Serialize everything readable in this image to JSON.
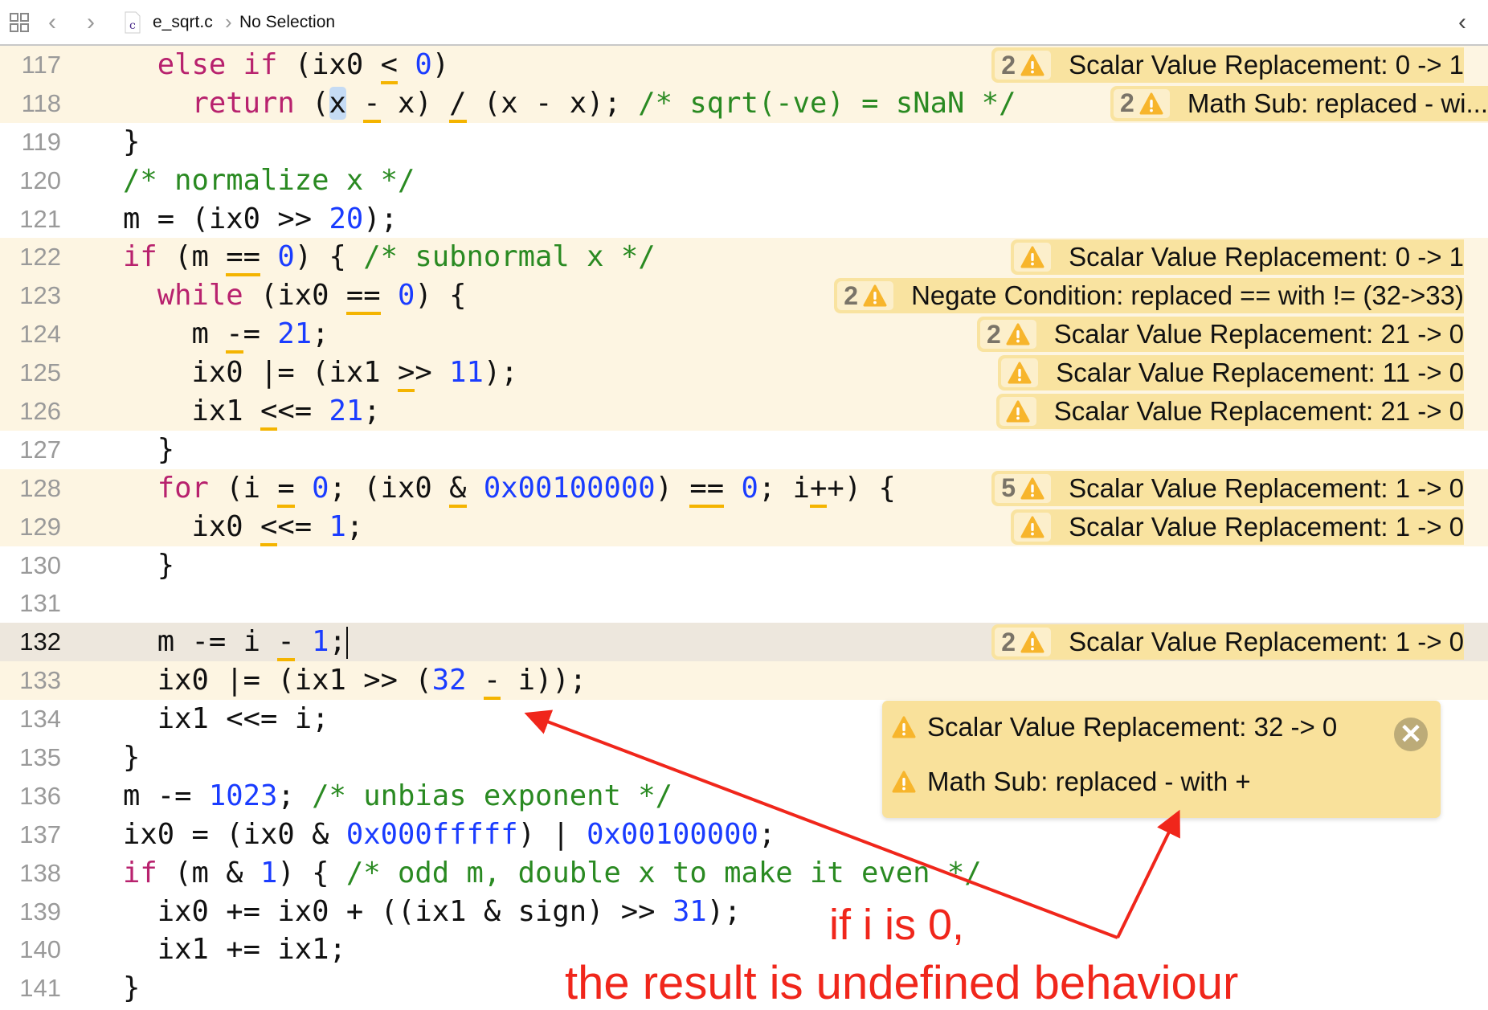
{
  "toolbar": {
    "file_name": "e_sqrt.c",
    "file_type_letter": "c",
    "selection": "No Selection",
    "icons": [
      "related-items-grid-icon",
      "back-chevron-icon",
      "forward-chevron-icon",
      "c-file-icon",
      "breadcrumb-chevron-icon",
      "issue-nav-back-icon"
    ]
  },
  "colors": {
    "keyword": "#b8226e",
    "number": "#1a3cff",
    "comment": "#2a8a22",
    "mutation_underline": "#f4b400",
    "annotation_bg": "#f9e3a0",
    "row_highlight": "#fdf5e2",
    "current_line": "#ede7dd",
    "annotation_red": "#f0261b"
  },
  "current_line": 132,
  "lines": [
    {
      "n": "117",
      "hl": true,
      "tokens": [
        [
          "p",
          "  "
        ],
        [
          "k",
          "else if"
        ],
        [
          "p",
          " (ix0 "
        ],
        [
          "m",
          "<"
        ],
        [
          "p",
          " "
        ],
        [
          "n",
          "0"
        ],
        [
          "p",
          ")"
        ]
      ],
      "ann": {
        "count": "2",
        "text": "Scalar Value Replacement: 0 -> 1"
      }
    },
    {
      "n": "118",
      "hl": true,
      "tokens": [
        [
          "p",
          "    "
        ],
        [
          "k",
          "return"
        ],
        [
          "p",
          " ("
        ],
        [
          "s",
          "x"
        ],
        [
          "p",
          " "
        ],
        [
          "m",
          "-"
        ],
        [
          "p",
          " x) "
        ],
        [
          "m",
          "/"
        ],
        [
          "p",
          " (x - x); "
        ],
        [
          "c",
          "/* sqrt(-ve) = sNaN */"
        ]
      ],
      "ann": {
        "count": "2",
        "text": "Math Sub: replaced - wi...",
        "truncated": true
      }
    },
    {
      "n": "119",
      "tokens": [
        [
          "p",
          "}"
        ]
      ]
    },
    {
      "n": "120",
      "tokens": [
        [
          "c",
          "/* normalize x */"
        ]
      ]
    },
    {
      "n": "121",
      "tokens": [
        [
          "p",
          "m = (ix0 >> "
        ],
        [
          "n",
          "20"
        ],
        [
          "p",
          ");"
        ]
      ]
    },
    {
      "n": "122",
      "hl": true,
      "tokens": [
        [
          "k",
          "if"
        ],
        [
          "p",
          " (m "
        ],
        [
          "m",
          "=="
        ],
        [
          "p",
          " "
        ],
        [
          "n",
          "0"
        ],
        [
          "p",
          ") { "
        ],
        [
          "c",
          "/* subnormal x */"
        ]
      ],
      "ann": {
        "count": "",
        "text": "Scalar Value Replacement: 0 -> 1"
      }
    },
    {
      "n": "123",
      "hl": true,
      "tokens": [
        [
          "p",
          "  "
        ],
        [
          "k",
          "while"
        ],
        [
          "p",
          " (ix0 "
        ],
        [
          "m",
          "=="
        ],
        [
          "p",
          " "
        ],
        [
          "n",
          "0"
        ],
        [
          "p",
          ") {"
        ]
      ],
      "ann": {
        "count": "2",
        "text": "Negate Condition: replaced == with != (32->33)"
      }
    },
    {
      "n": "124",
      "hl": true,
      "tokens": [
        [
          "p",
          "    m "
        ],
        [
          "m",
          "-"
        ],
        [
          "p",
          "= "
        ],
        [
          "n",
          "21"
        ],
        [
          "p",
          ";"
        ]
      ],
      "ann": {
        "count": "2",
        "text": "Scalar Value Replacement: 21 -> 0"
      }
    },
    {
      "n": "125",
      "hl": true,
      "tokens": [
        [
          "p",
          "    ix0 |= (ix1 "
        ],
        [
          "m",
          ">"
        ],
        [
          "p",
          "> "
        ],
        [
          "n",
          "11"
        ],
        [
          "p",
          ");"
        ]
      ],
      "ann": {
        "count": "",
        "text": "Scalar Value Replacement: 11 -> 0"
      }
    },
    {
      "n": "126",
      "hl": true,
      "tokens": [
        [
          "p",
          "    ix1 "
        ],
        [
          "m",
          "<"
        ],
        [
          "p",
          "<= "
        ],
        [
          "n",
          "21"
        ],
        [
          "p",
          ";"
        ]
      ],
      "ann": {
        "count": "",
        "text": "Scalar Value Replacement: 21 -> 0"
      }
    },
    {
      "n": "127",
      "tokens": [
        [
          "p",
          "  }"
        ]
      ]
    },
    {
      "n": "128",
      "hl": true,
      "tokens": [
        [
          "p",
          "  "
        ],
        [
          "k",
          "for"
        ],
        [
          "p",
          " (i "
        ],
        [
          "m",
          "="
        ],
        [
          "p",
          " "
        ],
        [
          "n",
          "0"
        ],
        [
          "p",
          "; (ix0 "
        ],
        [
          "m",
          "&"
        ],
        [
          "p",
          " "
        ],
        [
          "n",
          "0x00100000"
        ],
        [
          "p",
          ") "
        ],
        [
          "m",
          "=="
        ],
        [
          "p",
          " "
        ],
        [
          "n",
          "0"
        ],
        [
          "p",
          "; i"
        ],
        [
          "m",
          "+"
        ],
        [
          "p",
          "+) {"
        ]
      ],
      "ann": {
        "count": "5",
        "text": "Scalar Value Replacement: 1 -> 0"
      }
    },
    {
      "n": "129",
      "hl": true,
      "tokens": [
        [
          "p",
          "    ix0 "
        ],
        [
          "m",
          "<"
        ],
        [
          "p",
          "<= "
        ],
        [
          "n",
          "1"
        ],
        [
          "p",
          ";"
        ]
      ],
      "ann": {
        "count": "",
        "text": "Scalar Value Replacement: 1 -> 0"
      }
    },
    {
      "n": "130",
      "tokens": [
        [
          "p",
          "  }"
        ]
      ]
    },
    {
      "n": "131",
      "tokens": []
    },
    {
      "n": "132",
      "cur": true,
      "tokens": [
        [
          "p",
          "  m -= i "
        ],
        [
          "m",
          "-"
        ],
        [
          "p",
          " "
        ],
        [
          "n",
          "1"
        ],
        [
          "p",
          ";"
        ]
      ],
      "ann": {
        "count": "2",
        "text": "Scalar Value Replacement: 1 -> 0"
      }
    },
    {
      "n": "133",
      "hl": true,
      "tokens": [
        [
          "p",
          "  ix0 |= (ix1 >> ("
        ],
        [
          "n",
          "32"
        ],
        [
          "p",
          " "
        ],
        [
          "m",
          "-"
        ],
        [
          "p",
          " i));"
        ]
      ]
    },
    {
      "n": "134",
      "tokens": [
        [
          "p",
          "  ix1 <<= i;"
        ]
      ]
    },
    {
      "n": "135",
      "tokens": [
        [
          "p",
          "}"
        ]
      ]
    },
    {
      "n": "136",
      "tokens": [
        [
          "p",
          "m -= "
        ],
        [
          "n",
          "1023"
        ],
        [
          "p",
          "; "
        ],
        [
          "c",
          "/* unbias exponent */"
        ]
      ]
    },
    {
      "n": "137",
      "tokens": [
        [
          "p",
          "ix0 = (ix0 & "
        ],
        [
          "n",
          "0x000fffff"
        ],
        [
          "p",
          ") | "
        ],
        [
          "n",
          "0x00100000"
        ],
        [
          "p",
          ";"
        ]
      ]
    },
    {
      "n": "138",
      "tokens": [
        [
          "k",
          "if"
        ],
        [
          "p",
          " (m & "
        ],
        [
          "n",
          "1"
        ],
        [
          "p",
          ") { "
        ],
        [
          "c",
          "/* odd m, double x to make it even */"
        ]
      ]
    },
    {
      "n": "139",
      "tokens": [
        [
          "p",
          "  ix0 += ix0 + ((ix1 & sign) >> "
        ],
        [
          "n",
          "31"
        ],
        [
          "p",
          ");"
        ]
      ]
    },
    {
      "n": "140",
      "tokens": [
        [
          "p",
          "  ix1 += ix1;"
        ]
      ]
    },
    {
      "n": "141",
      "tokens": [
        [
          "p",
          "}"
        ]
      ]
    }
  ],
  "popup": {
    "line": "133",
    "items": [
      "Scalar Value Replacement: 32 -> 0",
      "Math Sub: replaced - with +"
    ],
    "close_icon": "close-icon"
  },
  "annotation": {
    "line1": "if i is 0,",
    "line2": "the result is undefined behaviour"
  }
}
